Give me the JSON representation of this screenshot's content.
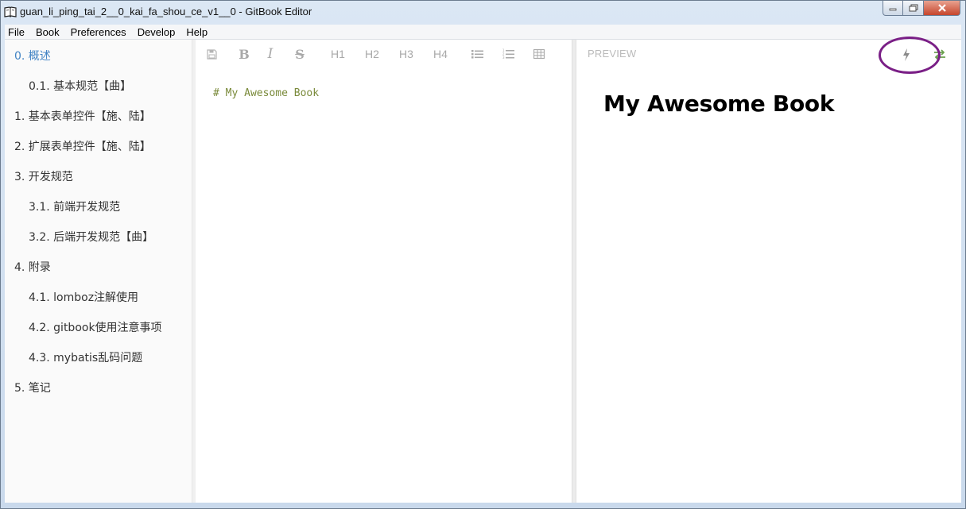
{
  "window": {
    "title": "guan_li_ping_tai_2__0_kai_fa_shou_ce_v1__0 - GitBook Editor"
  },
  "menu": [
    "File",
    "Book",
    "Preferences",
    "Develop",
    "Help"
  ],
  "sidebar": {
    "items": [
      {
        "label": "0. 概述",
        "active": true
      },
      {
        "label": "0.1. 基本规范【曲】"
      },
      {
        "label": "1. 基本表单控件【施、陆】"
      },
      {
        "label": "2. 扩展表单控件【施、陆】"
      },
      {
        "label": "3. 开发规范"
      },
      {
        "label": "3.1. 前端开发规范"
      },
      {
        "label": "3.2. 后端开发规范【曲】"
      },
      {
        "label": "4. 附录"
      },
      {
        "label": "4.1. lomboz注解使用"
      },
      {
        "label": "4.2. gitbook使用注意事项"
      },
      {
        "label": "4.3. mybatis乱码问题"
      },
      {
        "label": "5. 笔记"
      }
    ]
  },
  "toolbar": {
    "bold": "B",
    "italic": "I",
    "strike": "S",
    "h1": "H1",
    "h2": "H2",
    "h3": "H3",
    "h4": "H4",
    "icons": [
      "save-icon",
      "bullet-list-icon",
      "numbered-list-icon",
      "table-icon"
    ]
  },
  "editor": {
    "content": "# My Awesome Book"
  },
  "preview": {
    "label": "PREVIEW",
    "heading": "My Awesome Book",
    "icons": [
      "lightning-icon",
      "swap-icon"
    ]
  },
  "colors": {
    "active_link": "#4183c4",
    "annotation": "#7a1f86",
    "markdown_text": "#7a8a3a"
  }
}
